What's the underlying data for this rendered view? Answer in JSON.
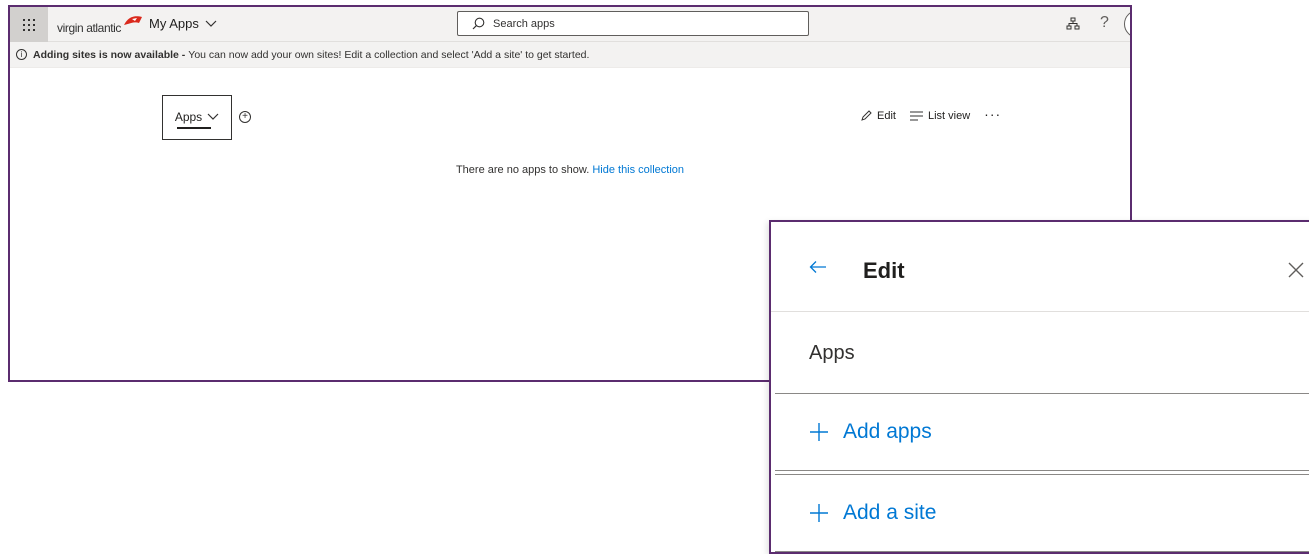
{
  "header": {
    "brand": "virgin atlantic",
    "app_switcher_label": "My Apps",
    "search": {
      "placeholder": "Search apps"
    },
    "help_label": "?"
  },
  "notice": {
    "bold": "Adding sites is now available -",
    "text": "You can now add your own sites! Edit a collection and select 'Add a site' to get started."
  },
  "collection": {
    "tab_label": "Apps"
  },
  "commands": {
    "edit": "Edit",
    "list_view": "List view",
    "more": "···"
  },
  "empty_state": {
    "text": "There are no apps to show.",
    "link": "Hide this collection"
  },
  "edit_panel": {
    "title": "Edit",
    "section": "Apps",
    "actions": [
      {
        "label": "Add apps"
      },
      {
        "label": "Add a site"
      }
    ]
  },
  "colors": {
    "accent": "#0078d4",
    "border_frame": "#5b2c6f",
    "topbar": "#f3f2f1",
    "brand_red": "#da291c"
  }
}
